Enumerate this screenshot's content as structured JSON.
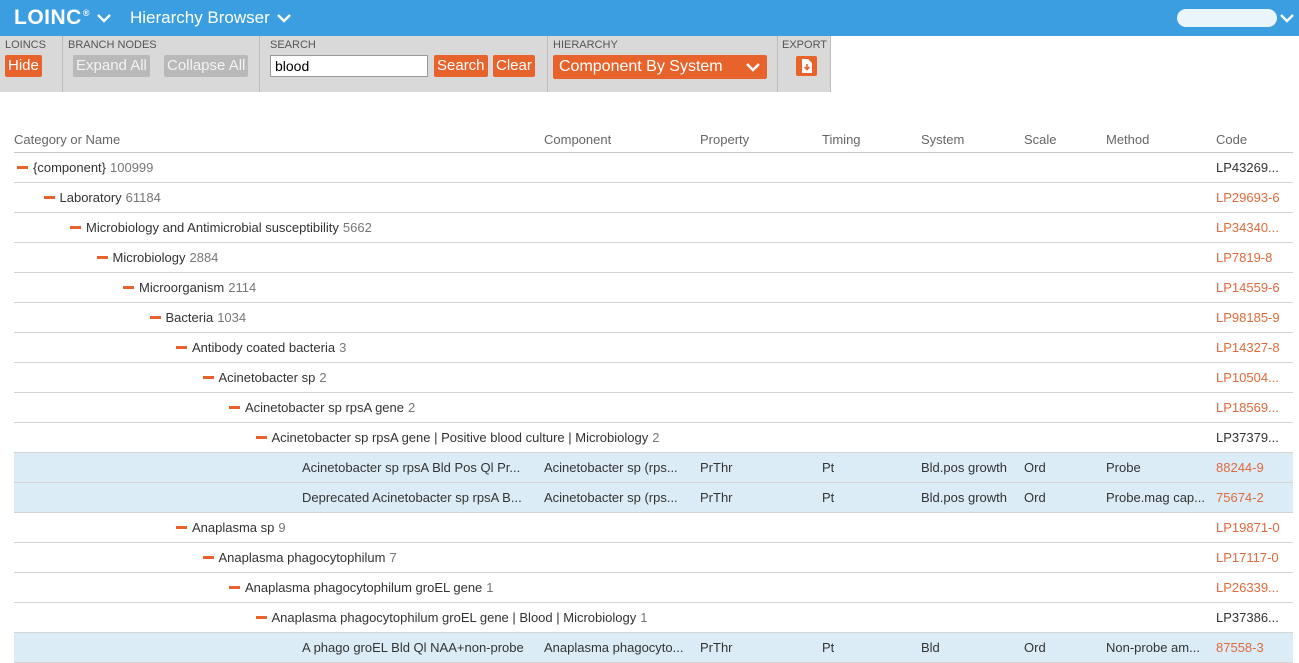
{
  "header": {
    "logo": "LOINC",
    "logo_mark": "®",
    "app_title": "Hierarchy Browser"
  },
  "toolbar": {
    "loincs_label": "LOINCS",
    "hide_label": "Hide",
    "branch_nodes_label": "BRANCH NODES",
    "expand_all_label": "Expand All",
    "collapse_all_label": "Collapse All",
    "search_label": "SEARCH",
    "search_value": "blood",
    "search_button": "Search",
    "clear_button": "Clear",
    "hierarchy_label": "HIERARCHY",
    "hierarchy_value": "Component By System",
    "export_label": "EXPORT"
  },
  "table": {
    "columns": [
      "Category or Name",
      "Component",
      "Property",
      "Timing",
      "System",
      "Scale",
      "Method",
      "Code"
    ],
    "rows": [
      {
        "type": "branch",
        "level": 0,
        "name": "{component}",
        "count": "100999",
        "code": "LP43269...",
        "code_link": false
      },
      {
        "type": "branch",
        "level": 1,
        "name": "Laboratory",
        "count": "61184",
        "code": "LP29693-6",
        "code_link": true
      },
      {
        "type": "branch",
        "level": 2,
        "name": "Microbiology and Antimicrobial susceptibility",
        "count": "5662",
        "code": "LP34340...",
        "code_link": true
      },
      {
        "type": "branch",
        "level": 3,
        "name": "Microbiology",
        "count": "2884",
        "code": "LP7819-8",
        "code_link": true
      },
      {
        "type": "branch",
        "level": 4,
        "name": "Microorganism",
        "count": "2114",
        "code": "LP14559-6",
        "code_link": true
      },
      {
        "type": "branch",
        "level": 5,
        "name": "Bacteria",
        "count": "1034",
        "code": "LP98185-9",
        "code_link": true
      },
      {
        "type": "branch",
        "level": 6,
        "name": "Antibody coated bacteria",
        "count": "3",
        "code": "LP14327-8",
        "code_link": true
      },
      {
        "type": "branch",
        "level": 7,
        "name": "Acinetobacter sp",
        "count": "2",
        "code": "LP10504...",
        "code_link": true
      },
      {
        "type": "branch",
        "level": 8,
        "name": "Acinetobacter sp rpsA gene",
        "count": "2",
        "code": "LP18569...",
        "code_link": true
      },
      {
        "type": "branch",
        "level": 9,
        "name": "Acinetobacter sp rpsA gene | Positive blood culture | Microbiology",
        "count": "2",
        "code": "LP37379...",
        "code_link": false
      },
      {
        "type": "leaf",
        "name": "Acinetobacter sp rpsA Bld Pos Ql Pr...",
        "component": "Acinetobacter sp (rps...",
        "property": "PrThr",
        "timing": "Pt",
        "system": "Bld.pos growth",
        "scale": "Ord",
        "method": "Probe",
        "code": "88244-9",
        "code_link": true
      },
      {
        "type": "leaf",
        "name": "Deprecated Acinetobacter sp rpsA B...",
        "component": "Acinetobacter sp (rps...",
        "property": "PrThr",
        "timing": "Pt",
        "system": "Bld.pos growth",
        "scale": "Ord",
        "method": "Probe.mag cap...",
        "code": "75674-2",
        "code_link": true
      },
      {
        "type": "branch",
        "level": 6,
        "name": "Anaplasma sp",
        "count": "9",
        "code": "LP19871-0",
        "code_link": true
      },
      {
        "type": "branch",
        "level": 7,
        "name": "Anaplasma phagocytophilum",
        "count": "7",
        "code": "LP17117-0",
        "code_link": true
      },
      {
        "type": "branch",
        "level": 8,
        "name": "Anaplasma phagocytophilum groEL gene",
        "count": "1",
        "code": "LP26339...",
        "code_link": true
      },
      {
        "type": "branch",
        "level": 9,
        "name": "Anaplasma phagocytophilum groEL gene | Blood | Microbiology",
        "count": "1",
        "code": "LP37386...",
        "code_link": false
      },
      {
        "type": "leaf",
        "name": "A phago groEL Bld Ql NAA+non-probe",
        "component": "Anaplasma phagocyto...",
        "property": "PrThr",
        "timing": "Pt",
        "system": "Bld",
        "scale": "Ord",
        "method": "Non-probe am...",
        "code": "87558-3",
        "code_link": true
      }
    ]
  },
  "colors": {
    "brand_blue": "#3a9ee0",
    "accent_orange": "#e8632c",
    "leaf_row_bg": "#dcecf7"
  }
}
